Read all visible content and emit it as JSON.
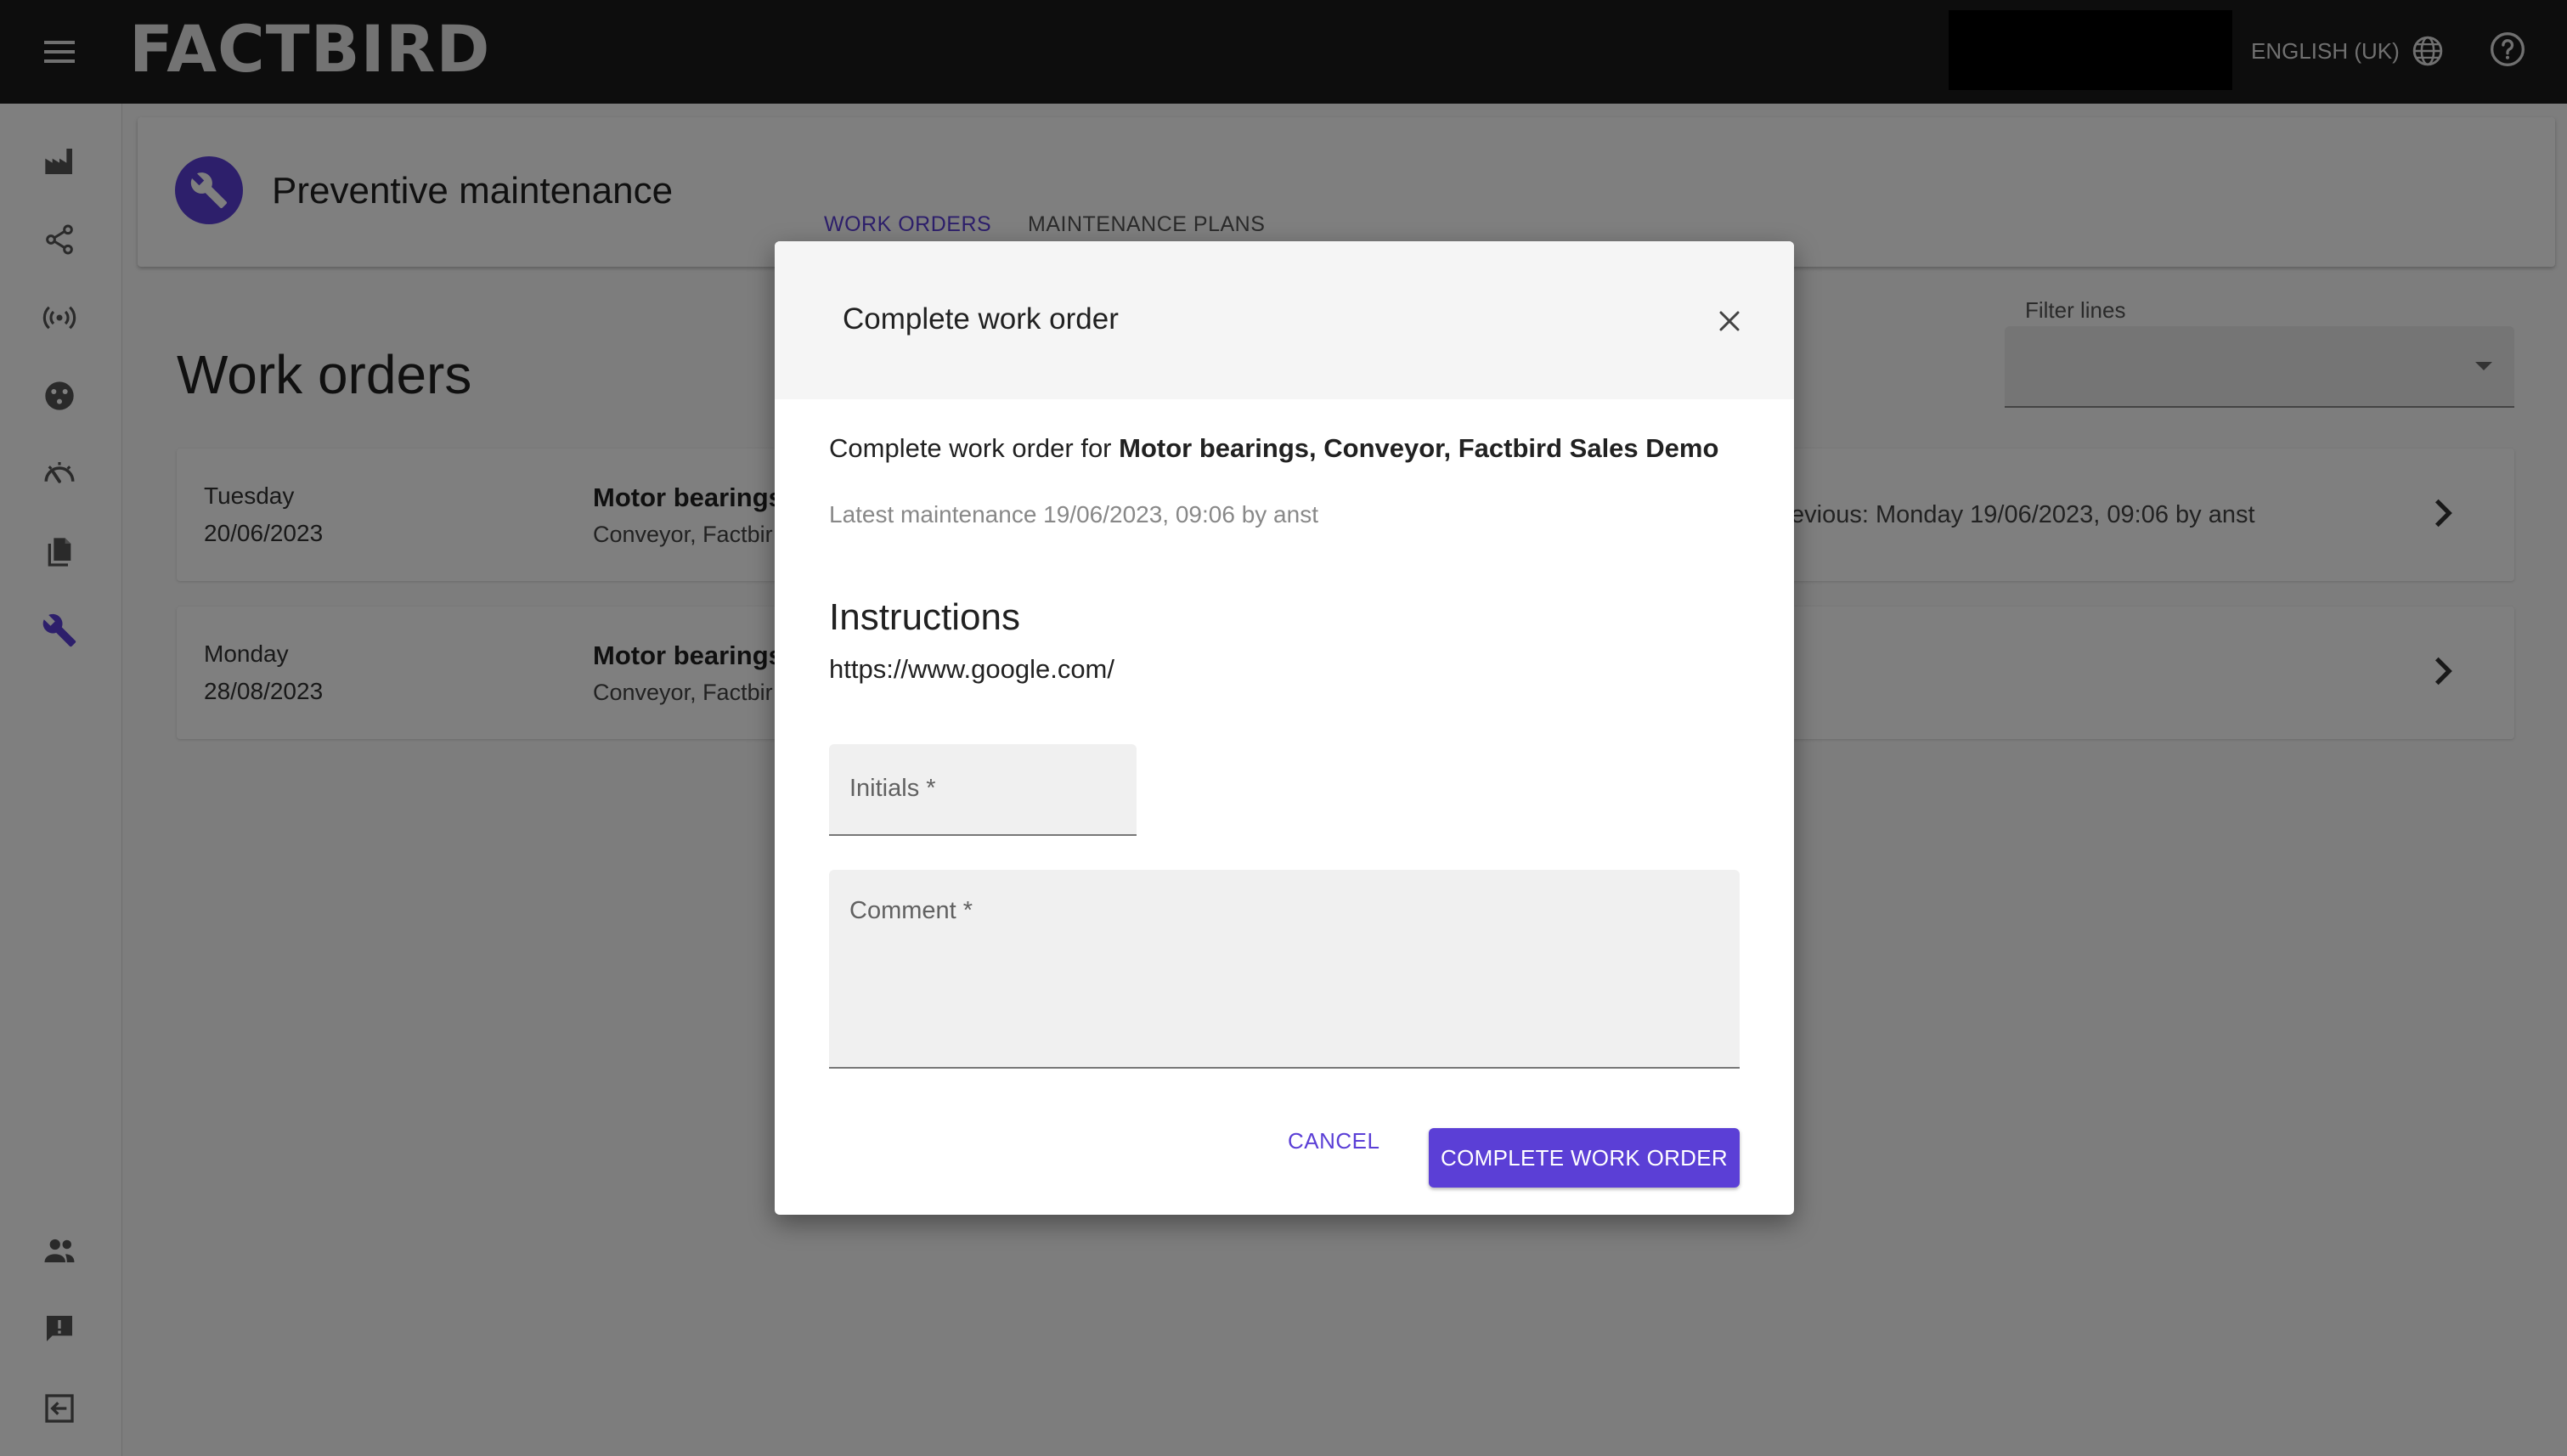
{
  "app": {
    "logo": "FACTBIRD",
    "language": "ENGLISH (UK)"
  },
  "header": {
    "title": "Preventive maintenance",
    "tabs": [
      {
        "label": "WORK ORDERS",
        "active": true
      },
      {
        "label": "MAINTENANCE PLANS",
        "active": false
      }
    ]
  },
  "page": {
    "heading": "Work orders",
    "filter_label": "Filter lines",
    "filter_value": ""
  },
  "work_orders": [
    {
      "day": "Tuesday",
      "date": "20/06/2023",
      "name": "Motor bearings",
      "sub": "Conveyor, Factbir",
      "previous": "evious: Monday 19/06/2023, 09:06 by anst"
    },
    {
      "day": "Monday",
      "date": "28/08/2023",
      "name": "Motor bearings",
      "sub": "Conveyor, Factbir",
      "previous": ""
    }
  ],
  "dialog": {
    "title": "Complete work order",
    "desc_prefix": "Complete work order for ",
    "desc_target": "Motor bearings, Conveyor, Factbird Sales Demo",
    "latest": "Latest maintenance 19/06/2023, 09:06 by anst",
    "instructions_heading": "Instructions",
    "instructions_link": "https://www.google.com/",
    "initials_label": "Initials *",
    "comment_label": "Comment *",
    "cancel_label": "CANCEL",
    "complete_label": "COMPLETE WORK ORDER"
  },
  "colors": {
    "accent": "#5b3fd6",
    "topbar": "#1b1b1b"
  },
  "sidebar_icons": [
    "factory-icon",
    "share-nodes-icon",
    "sensor-signal-icon",
    "palette-icon",
    "speed-gauge-icon",
    "documents-icon",
    "wrench-icon",
    "people-icon",
    "feedback-icon",
    "logout-icon"
  ]
}
